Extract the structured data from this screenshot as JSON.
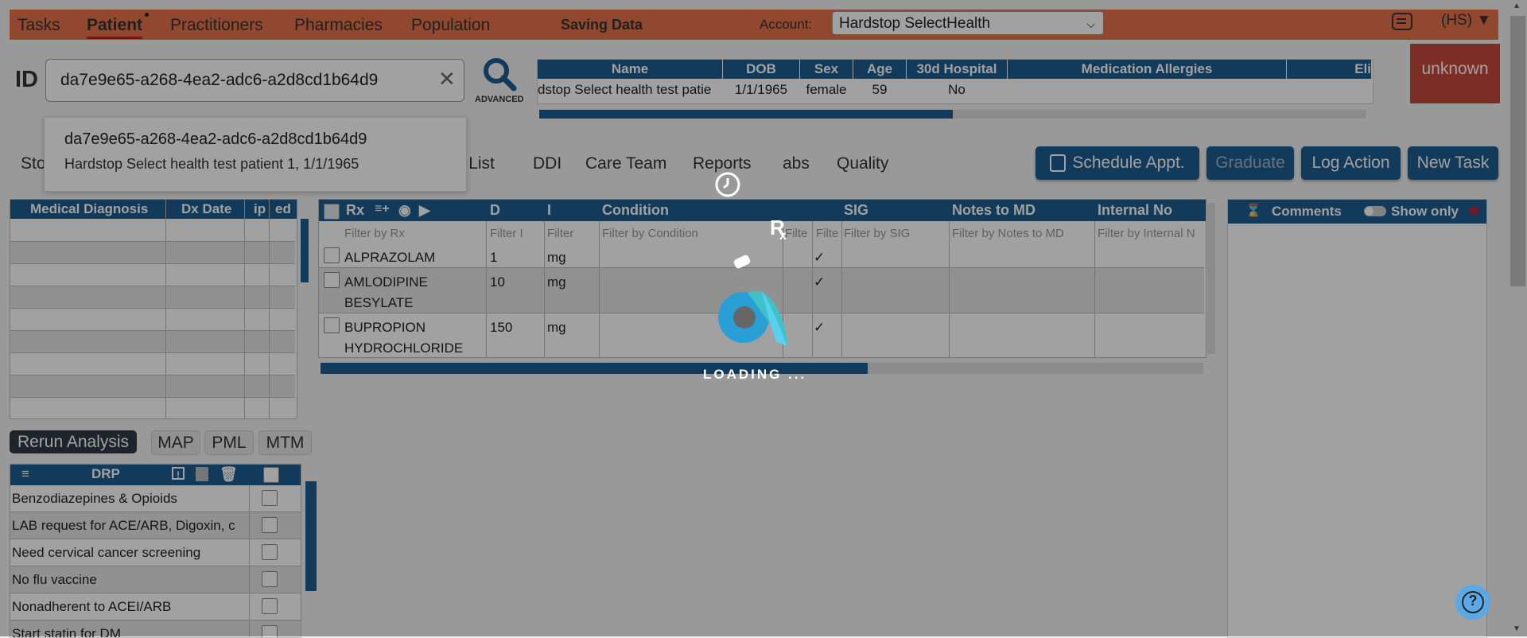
{
  "nav": {
    "tabs": [
      "Tasks",
      "Patient",
      "Practitioners",
      "Pharmacies",
      "Population"
    ],
    "saving": "Saving Data",
    "account_label": "Account:",
    "account_value": "Hardstop SelectHealth",
    "user_initials": "(HS)"
  },
  "search": {
    "id_label": "ID",
    "value": "da7e9e65-a268-4ea2-adc6-a2d8cd1b64d9",
    "advanced_label": "ADVANCED"
  },
  "autocomplete": {
    "id": "da7e9e65-a268-4ea2-adc6-a2d8cd1b64d9",
    "description": "Hardstop Select health test patient 1, 1/1/1965"
  },
  "patient_header": {
    "columns": [
      "Name",
      "DOB",
      "Sex",
      "Age",
      "30d Hospital",
      "Medication Allergies",
      "Eli"
    ],
    "name": "dstop Select health test patie",
    "dob": "1/1/1965",
    "sex": "female",
    "age": "59",
    "hospital_30d": "No",
    "progress": 0.5,
    "status_badge": "unknown"
  },
  "subtabs": [
    "Sto",
    "ed List",
    "DDI",
    "Care Team",
    "Reports",
    "abs",
    "Quality"
  ],
  "action_buttons": {
    "schedule": "Schedule Appt.",
    "graduate": "Graduate",
    "log_action": "Log Action",
    "new_task": "New Task"
  },
  "diagnosis": {
    "columns": [
      "Medical Diagnosis",
      "Dx Date",
      "ip",
      "ed"
    ]
  },
  "analysis": {
    "rerun": "Rerun Analysis",
    "pills": [
      "MAP",
      "PML",
      "MTM"
    ]
  },
  "drp": {
    "header": "DRP",
    "items": [
      "Benzodiazepines & Opioids",
      "LAB request for ACE/ARB, Digoxin, c",
      "Need cervical cancer screening",
      "No flu vaccine",
      "Nonadherent to ACEI/ARB",
      "Start statin for DM"
    ]
  },
  "meds": {
    "columns": [
      "Rx",
      "D",
      "I",
      "Condition",
      "SIG",
      "Notes to MD",
      "Internal No"
    ],
    "filters": [
      "Filter by Rx",
      "Filter I",
      "Filter",
      "Filter by Condition",
      "Filte",
      "Filte",
      "Filter by SIG",
      "Filter by Notes to MD",
      "Filter by Internal N"
    ],
    "rows": [
      {
        "rx": "ALPRAZOLAM",
        "dose": "1",
        "unit": "mg",
        "check": "✓"
      },
      {
        "rx": "AMLODIPINE BESYLATE",
        "rx1": "AMLODIPINE",
        "rx2": "BESYLATE",
        "dose": "10",
        "unit": "mg",
        "check": "✓"
      },
      {
        "rx": "BUPROPION HYDROCHLORIDE",
        "rx1": "BUPROPION",
        "rx2": "HYDROCHLORIDE",
        "dose": "150",
        "unit": "mg",
        "check": "✓"
      }
    ],
    "progress": 0.62
  },
  "comments": {
    "title": "Comments",
    "show_only": "Show only"
  },
  "loading": {
    "text": "LOADING ..."
  },
  "colors": {
    "nav_bg": "#e8734a",
    "primary": "#1e5d8f",
    "badge": "#c44a3a"
  }
}
